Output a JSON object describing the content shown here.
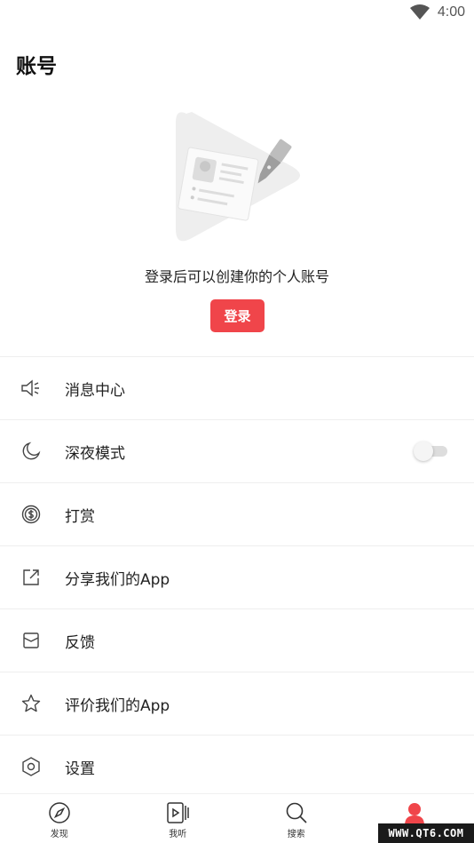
{
  "status_bar": {
    "time": "4:00",
    "wifi_icon": "wifi-icon"
  },
  "header": {
    "title": "账号"
  },
  "login_section": {
    "illustration_icon": "profile-card-pen-illustration",
    "hint": "登录后可以创建你的个人账号",
    "button_label": "登录"
  },
  "menu": {
    "items": [
      {
        "label": "消息中心",
        "icon": "megaphone-icon"
      },
      {
        "label": "深夜模式",
        "icon": "moon-icon",
        "toggle_on": false
      },
      {
        "label": "打赏",
        "icon": "coin-icon"
      },
      {
        "label": "分享我们的App",
        "icon": "share-icon"
      },
      {
        "label": "反馈",
        "icon": "envelope-icon"
      },
      {
        "label": "评价我们的App",
        "icon": "star-icon"
      },
      {
        "label": "设置",
        "icon": "hexagon-settings-icon"
      }
    ]
  },
  "tab_bar": {
    "tabs": [
      {
        "label": "发现",
        "icon": "compass-icon",
        "active": false
      },
      {
        "label": "我听",
        "icon": "playlist-icon",
        "active": false
      },
      {
        "label": "搜索",
        "icon": "search-icon",
        "active": false
      },
      {
        "label": "账号",
        "icon": "user-icon",
        "active": true
      }
    ]
  },
  "colors": {
    "accent": "#f0454a",
    "divider": "#eeeeee",
    "text": "#222222"
  },
  "watermark": "WWW.QT6.COM"
}
